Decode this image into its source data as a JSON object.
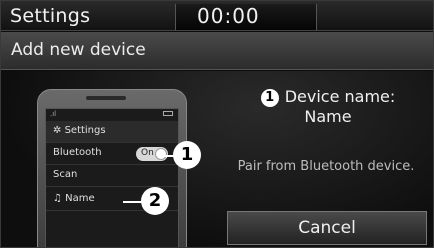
{
  "statusbar": {
    "title": "Settings",
    "clock": "00:00"
  },
  "subheader": {
    "title": "Add new device"
  },
  "phone": {
    "settings_label": "Settings",
    "settings_icon": "gear-icon",
    "bluetooth_label": "Bluetooth",
    "toggle_label": "On",
    "scan_label": "Scan",
    "device_label": "Name",
    "device_icon": "headphones-icon"
  },
  "callouts": {
    "one": "1",
    "two": "2"
  },
  "device": {
    "number": "1",
    "label_line1": "Device name:",
    "label_line2": "Name"
  },
  "pair_hint": "Pair from Bluetooth device.",
  "cancel_label": "Cancel"
}
